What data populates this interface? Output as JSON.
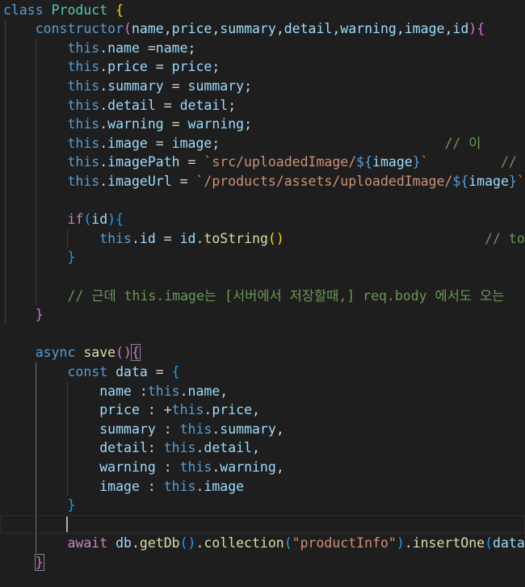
{
  "editor": {
    "theme_colors": {
      "background": "#1e1e1e",
      "keyword": "#569cd6",
      "class_name": "#4ec9b0",
      "function": "#dcdcaa",
      "variable": "#9cdcfe",
      "string": "#ce9178",
      "comment": "#6a9955",
      "bracket_gold": "#ffd700",
      "bracket_magenta": "#da70d6",
      "bracket_blue": "#179fff"
    },
    "lines": [
      [
        {
          "t": "class",
          "c": "kw"
        },
        {
          "t": " "
        },
        {
          "t": "Product",
          "c": "cls"
        },
        {
          "t": " "
        },
        {
          "t": "{",
          "c": "p1"
        }
      ],
      [
        {
          "t": "    "
        },
        {
          "t": "constructor",
          "c": "kw"
        },
        {
          "t": "(",
          "c": "p2"
        },
        {
          "t": "name",
          "c": "var"
        },
        {
          "t": ","
        },
        {
          "t": "price",
          "c": "var"
        },
        {
          "t": ","
        },
        {
          "t": "summary",
          "c": "var"
        },
        {
          "t": ","
        },
        {
          "t": "detail",
          "c": "var"
        },
        {
          "t": ","
        },
        {
          "t": "warning",
          "c": "var"
        },
        {
          "t": ","
        },
        {
          "t": "image",
          "c": "var"
        },
        {
          "t": ","
        },
        {
          "t": "id",
          "c": "var"
        },
        {
          "t": ")",
          "c": "p2"
        },
        {
          "t": "{",
          "c": "p2"
        }
      ],
      [
        {
          "t": "        "
        },
        {
          "t": "this",
          "c": "kw"
        },
        {
          "t": "."
        },
        {
          "t": "name",
          "c": "var"
        },
        {
          "t": " ="
        },
        {
          "t": "name",
          "c": "var"
        },
        {
          "t": ";"
        }
      ],
      [
        {
          "t": "        "
        },
        {
          "t": "this",
          "c": "kw"
        },
        {
          "t": "."
        },
        {
          "t": "price",
          "c": "var"
        },
        {
          "t": " = "
        },
        {
          "t": "price",
          "c": "var"
        },
        {
          "t": ";"
        }
      ],
      [
        {
          "t": "        "
        },
        {
          "t": "this",
          "c": "kw"
        },
        {
          "t": "."
        },
        {
          "t": "summary",
          "c": "var"
        },
        {
          "t": " = "
        },
        {
          "t": "summary",
          "c": "var"
        },
        {
          "t": ";"
        }
      ],
      [
        {
          "t": "        "
        },
        {
          "t": "this",
          "c": "kw"
        },
        {
          "t": "."
        },
        {
          "t": "detail",
          "c": "var"
        },
        {
          "t": " = "
        },
        {
          "t": "detail",
          "c": "var"
        },
        {
          "t": ";"
        }
      ],
      [
        {
          "t": "        "
        },
        {
          "t": "this",
          "c": "kw"
        },
        {
          "t": "."
        },
        {
          "t": "warning",
          "c": "var"
        },
        {
          "t": " = "
        },
        {
          "t": "warning",
          "c": "var"
        },
        {
          "t": ";"
        }
      ],
      [
        {
          "t": "        "
        },
        {
          "t": "this",
          "c": "kw"
        },
        {
          "t": "."
        },
        {
          "t": "image",
          "c": "var"
        },
        {
          "t": " = "
        },
        {
          "t": "image",
          "c": "var"
        },
        {
          "t": ";                            "
        },
        {
          "t": "// 이",
          "c": "cm"
        }
      ],
      [
        {
          "t": "        "
        },
        {
          "t": "this",
          "c": "kw"
        },
        {
          "t": "."
        },
        {
          "t": "imagePath",
          "c": "var"
        },
        {
          "t": " = "
        },
        {
          "t": "`src/uploadedImage/",
          "c": "str"
        },
        {
          "t": "${",
          "c": "kw"
        },
        {
          "t": "image",
          "c": "var"
        },
        {
          "t": "}",
          "c": "kw"
        },
        {
          "t": "`",
          "c": "str"
        },
        {
          "t": "         "
        },
        {
          "t": "// 이",
          "c": "cm"
        }
      ],
      [
        {
          "t": "        "
        },
        {
          "t": "this",
          "c": "kw"
        },
        {
          "t": "."
        },
        {
          "t": "imageUrl",
          "c": "var"
        },
        {
          "t": " = "
        },
        {
          "t": "`/products/assets/uploadedImage/",
          "c": "str"
        },
        {
          "t": "${",
          "c": "kw"
        },
        {
          "t": "image",
          "c": "var"
        },
        {
          "t": "}",
          "c": "kw"
        },
        {
          "t": "`",
          "c": "str"
        }
      ],
      [],
      [
        {
          "t": "        "
        },
        {
          "t": "if",
          "c": "ctrl"
        },
        {
          "t": "(",
          "c": "p3"
        },
        {
          "t": "id",
          "c": "var"
        },
        {
          "t": ")",
          "c": "p3"
        },
        {
          "t": "{",
          "c": "p3"
        }
      ],
      [
        {
          "t": "            "
        },
        {
          "t": "this",
          "c": "kw"
        },
        {
          "t": "."
        },
        {
          "t": "id",
          "c": "var"
        },
        {
          "t": " = "
        },
        {
          "t": "id",
          "c": "var"
        },
        {
          "t": "."
        },
        {
          "t": "toString",
          "c": "fn"
        },
        {
          "t": "()",
          "c": "p1"
        },
        {
          "t": "                         "
        },
        {
          "t": "// toSt",
          "c": "cm"
        }
      ],
      [
        {
          "t": "        "
        },
        {
          "t": "}",
          "c": "p3"
        }
      ],
      [],
      [
        {
          "t": "        "
        },
        {
          "t": "// 근데 this.image는 [서버에서 저장할때,] req.body 에서도 오는",
          "c": "cm"
        }
      ],
      [
        {
          "t": "    "
        },
        {
          "t": "}",
          "c": "p2"
        }
      ],
      [],
      [
        {
          "t": "    "
        },
        {
          "t": "async",
          "c": "kw"
        },
        {
          "t": " "
        },
        {
          "t": "save",
          "c": "fn"
        },
        {
          "t": "()",
          "c": "p2"
        },
        {
          "t": "{",
          "c": "p2 bm"
        }
      ],
      [
        {
          "t": "        "
        },
        {
          "t": "const",
          "c": "kw"
        },
        {
          "t": " "
        },
        {
          "t": "data",
          "c": "var"
        },
        {
          "t": " = "
        },
        {
          "t": "{",
          "c": "p3"
        }
      ],
      [
        {
          "t": "            "
        },
        {
          "t": "name",
          "c": "var"
        },
        {
          "t": " :"
        },
        {
          "t": "this",
          "c": "kw"
        },
        {
          "t": "."
        },
        {
          "t": "name",
          "c": "var"
        },
        {
          "t": ","
        }
      ],
      [
        {
          "t": "            "
        },
        {
          "t": "price",
          "c": "var"
        },
        {
          "t": " : +"
        },
        {
          "t": "this",
          "c": "kw"
        },
        {
          "t": "."
        },
        {
          "t": "price",
          "c": "var"
        },
        {
          "t": ","
        }
      ],
      [
        {
          "t": "            "
        },
        {
          "t": "summary",
          "c": "var"
        },
        {
          "t": " : "
        },
        {
          "t": "this",
          "c": "kw"
        },
        {
          "t": "."
        },
        {
          "t": "summary",
          "c": "var"
        },
        {
          "t": ","
        }
      ],
      [
        {
          "t": "            "
        },
        {
          "t": "detail",
          "c": "var"
        },
        {
          "t": ": "
        },
        {
          "t": "this",
          "c": "kw"
        },
        {
          "t": "."
        },
        {
          "t": "detail",
          "c": "var"
        },
        {
          "t": ","
        }
      ],
      [
        {
          "t": "            "
        },
        {
          "t": "warning",
          "c": "var"
        },
        {
          "t": " : "
        },
        {
          "t": "this",
          "c": "kw"
        },
        {
          "t": "."
        },
        {
          "t": "warning",
          "c": "var"
        },
        {
          "t": ","
        }
      ],
      [
        {
          "t": "            "
        },
        {
          "t": "image",
          "c": "var"
        },
        {
          "t": " : "
        },
        {
          "t": "this",
          "c": "kw"
        },
        {
          "t": "."
        },
        {
          "t": "image",
          "c": "var"
        }
      ],
      [
        {
          "t": "        "
        },
        {
          "t": "}",
          "c": "p3"
        }
      ],
      [],
      [
        {
          "t": "        "
        },
        {
          "t": "await",
          "c": "ctrl"
        },
        {
          "t": " "
        },
        {
          "t": "db",
          "c": "var"
        },
        {
          "t": "."
        },
        {
          "t": "getDb",
          "c": "fn"
        },
        {
          "t": "()",
          "c": "p3"
        },
        {
          "t": "."
        },
        {
          "t": "collection",
          "c": "fn"
        },
        {
          "t": "(",
          "c": "p3"
        },
        {
          "t": "\"productInfo\"",
          "c": "str"
        },
        {
          "t": ")",
          "c": "p3"
        },
        {
          "t": "."
        },
        {
          "t": "insertOne",
          "c": "fn"
        },
        {
          "t": "(",
          "c": "p3"
        },
        {
          "t": "data",
          "c": "var"
        },
        {
          "t": ")",
          "c": "p3"
        }
      ],
      [
        {
          "t": "    "
        },
        {
          "t": "}",
          "c": "p2 bm"
        }
      ]
    ]
  }
}
